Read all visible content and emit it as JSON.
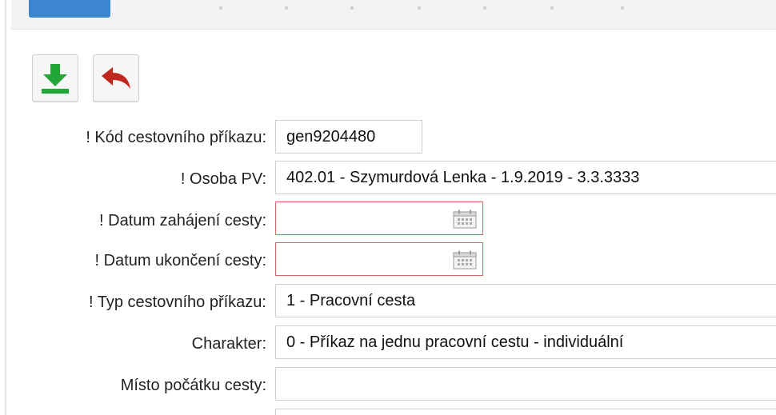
{
  "toolbar": {
    "save_icon": "download-save-icon",
    "back_icon": "undo-arrow-icon",
    "colors": {
      "save": "#23a638",
      "back": "#c0281f"
    }
  },
  "form": {
    "kod_label": "! Kód cestovního příkazu:",
    "kod_value": "gen9204480",
    "osoba_label": "! Osoba PV:",
    "osoba_value": "402.01 - Szymurdová Lenka - 1.9.2019 - 3.3.3333",
    "datum_zahajeni_label": "! Datum zahájení cesty:",
    "datum_zahajeni_value": "",
    "datum_ukonceni_label": "! Datum ukončení cesty:",
    "datum_ukonceni_value": "",
    "typ_label": "! Typ cestovního příkazu:",
    "typ_value": "1 - Pracovní cesta",
    "charakter_label": "Charakter:",
    "charakter_value": "0 - Příkaz na jednu pracovní cestu - individuální",
    "misto_label": "Místo počátku cesty:",
    "misto_value": ""
  },
  "colors": {
    "error_border": "#e06666",
    "accent": "#3c86cf"
  }
}
